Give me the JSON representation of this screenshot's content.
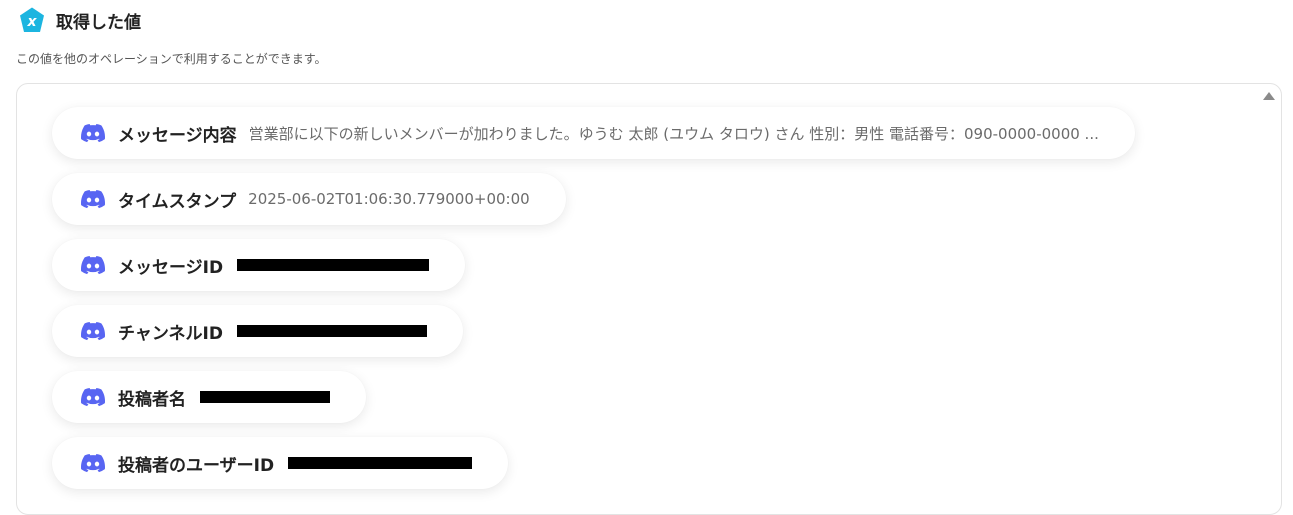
{
  "header": {
    "title": "取得した値",
    "logo_icon": "yoom-x-logo-icon",
    "logo_color": "#1CB5E0"
  },
  "subtitle": "この値を他のオペレーションで利用することができます。",
  "fields": [
    {
      "label": "メッセージ内容",
      "value": "営業部に以下の新しいメンバーが加わりました。ゆうむ 太郎 (ユウム タロウ) さん 性別：男性 電話番号：090-0000-0000 ..."
    },
    {
      "label": "タイムスタンプ",
      "value": "2025-06-02T01:06:30.779000+00:00"
    },
    {
      "label": "メッセージID",
      "value": ""
    },
    {
      "label": "チャンネルID",
      "value": ""
    },
    {
      "label": "投稿者名",
      "value": ""
    },
    {
      "label": "投稿者のユーザーID",
      "value": ""
    }
  ],
  "icon": "discord-icon",
  "discord_color": "#5865F2"
}
